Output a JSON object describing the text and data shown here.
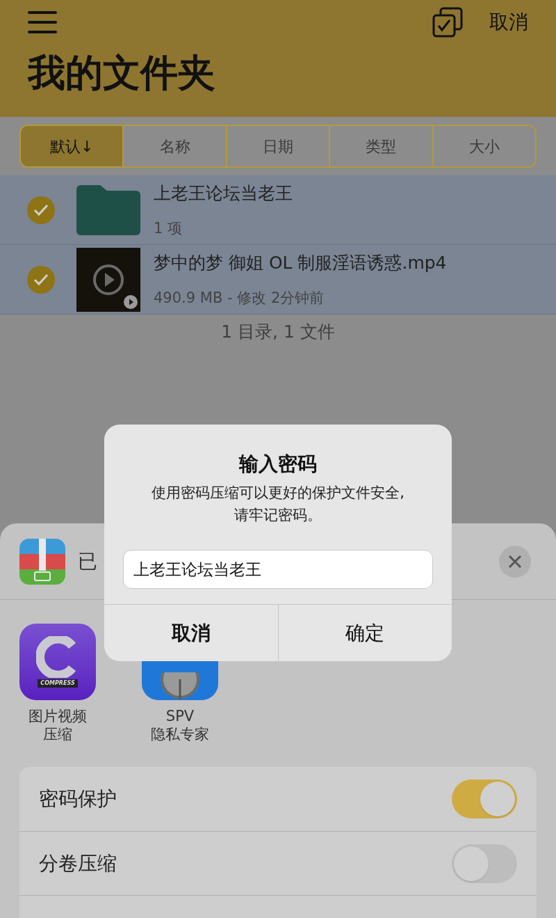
{
  "header": {
    "action": "取消",
    "title": "我的文件夹"
  },
  "sort_tabs": [
    {
      "label": "默认↓",
      "selected": true
    },
    {
      "label": "名称",
      "selected": false
    },
    {
      "label": "日期",
      "selected": false
    },
    {
      "label": "类型",
      "selected": false
    },
    {
      "label": "大小",
      "selected": false
    }
  ],
  "files": [
    {
      "kind": "folder",
      "name": "上老王论坛当老王",
      "detail": "1 项",
      "checked": true
    },
    {
      "kind": "video",
      "name": "梦中的梦 御姐 OL 制服淫语诱惑.mp4",
      "detail": "490.9 MB - 修改 2分钟前",
      "checked": true
    }
  ],
  "summary": "1 目录, 1 文件",
  "sheet": {
    "title": "已",
    "apps": [
      {
        "kind": "compress",
        "badge": "COMPRESS",
        "label": [
          "图片视频",
          "压缩"
        ]
      },
      {
        "kind": "vault",
        "label": [
          "SPV",
          "隐私专家"
        ]
      }
    ],
    "options": [
      {
        "kind": "toggle",
        "label": "密码保护",
        "on": true
      },
      {
        "kind": "toggle",
        "label": "分卷压缩",
        "on": false
      },
      {
        "kind": "cut"
      }
    ]
  },
  "dialog": {
    "title": "输入密码",
    "message": "使用密码压缩可以更好的保护文件安全,\n请牢记密码。",
    "value": "上老王论坛当老王",
    "buttons": [
      "取消",
      "确定"
    ]
  }
}
